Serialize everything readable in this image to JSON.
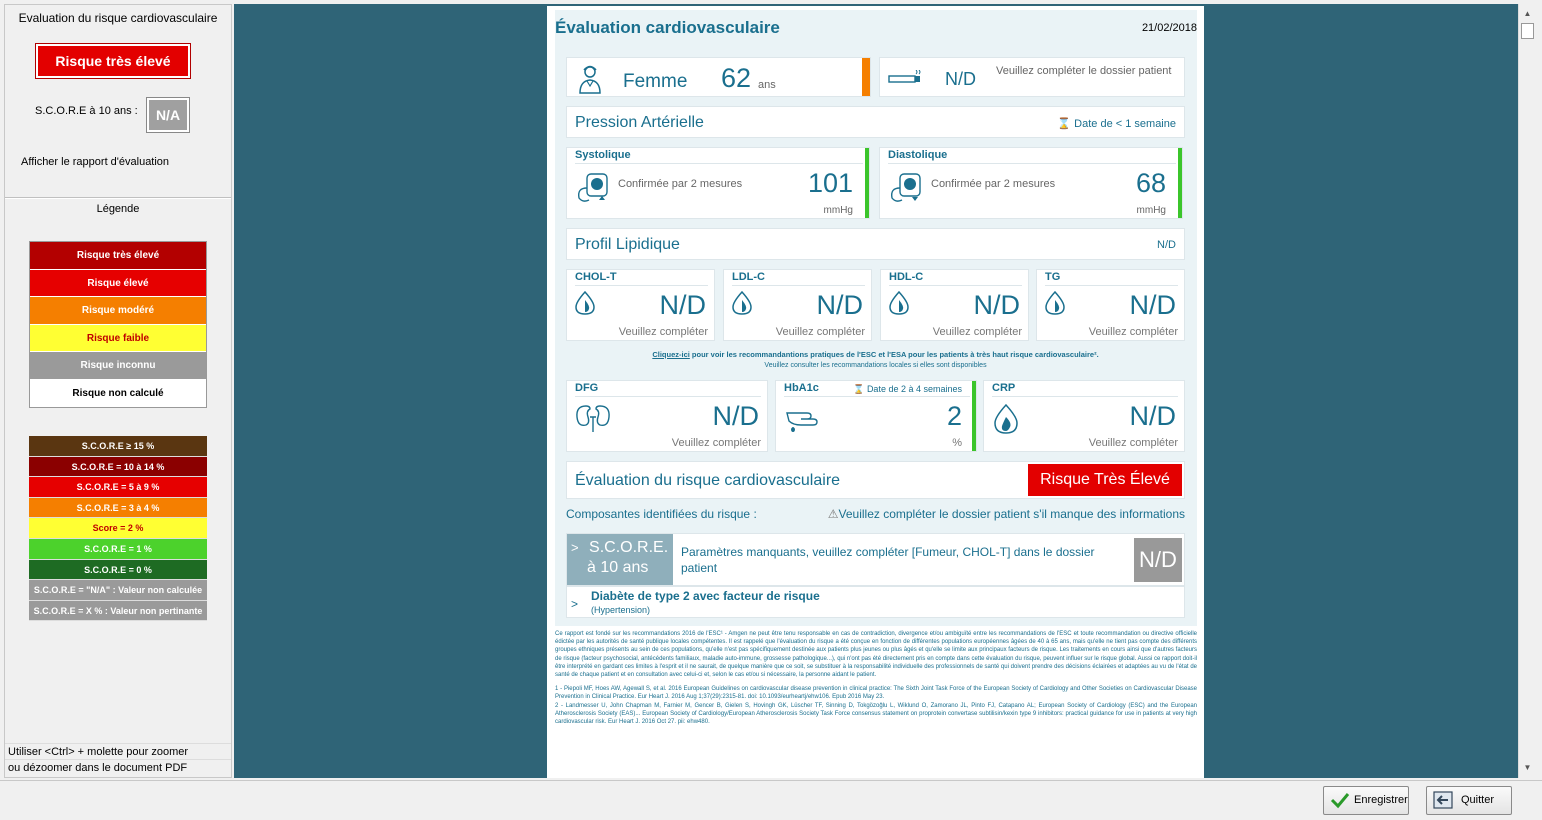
{
  "left_panel": {
    "title": "Evaluation du risque cardiovasculaire",
    "risk_badge": "Risque très élevé",
    "score_label": "S.C.O.R.E à 10 ans :",
    "score_value": "N/A",
    "report_link": "Afficher le rapport d'évaluation",
    "legend_title": "Légende",
    "legend": [
      {
        "label": "Risque très élevé",
        "bg": "#b30000",
        "fg": "#ffffff"
      },
      {
        "label": "Risque élevé",
        "bg": "#e60000",
        "fg": "#ffffff"
      },
      {
        "label": "Risque modéré",
        "bg": "#f57f00",
        "fg": "#ffffff"
      },
      {
        "label": "Risque faible",
        "bg": "#ffff33",
        "fg": "#c00000"
      },
      {
        "label": "Risque inconnu",
        "bg": "#9a9a9a",
        "fg": "#ffffff"
      },
      {
        "label": "Risque non calculé",
        "bg": "#ffffff",
        "fg": "#000000"
      }
    ],
    "score_legend": [
      {
        "label": "S.C.O.R.E ≥ 15 %",
        "bg": "#5a3611",
        "fg": "#ffffff"
      },
      {
        "label": "S.C.O.R.E = 10 à 14 %",
        "bg": "#8b0000",
        "fg": "#ffffff"
      },
      {
        "label": "S.C.O.R.E = 5 à 9 %",
        "bg": "#e60000",
        "fg": "#ffffff"
      },
      {
        "label": "S.C.O.R.E = 3 à 4 %",
        "bg": "#f57f00",
        "fg": "#ffffff"
      },
      {
        "label": "Score = 2 %",
        "bg": "#ffff33",
        "fg": "#c00000"
      },
      {
        "label": "S.C.O.R.E = 1 %",
        "bg": "#4cd22c",
        "fg": "#ffffff"
      },
      {
        "label": "S.C.O.R.E = 0 %",
        "bg": "#1e6b23",
        "fg": "#ffffff"
      },
      {
        "label": "S.C.O.R.E = \"N/A\" : Valeur non calculée",
        "bg": "#9a9a9a",
        "fg": "#ffffff"
      },
      {
        "label": "S.C.O.R.E = X % : Valeur non pertinante",
        "bg": "#9a9a9a",
        "fg": "#ffffff"
      }
    ],
    "zoom_hint": [
      "Utiliser <Ctrl> + molette pour zoomer",
      "ou dézoomer dans le document PDF"
    ]
  },
  "document": {
    "title": "Évaluation cardiovasculaire",
    "date": "21/02/2018",
    "patient": {
      "sex": "Femme",
      "age": "62",
      "age_unit": "ans"
    },
    "smoker": {
      "value": "N/D",
      "message": "Veuillez compléter le dossier patient"
    },
    "bp_section": {
      "label": "Pression Artérielle",
      "date_note": "Date de < 1 semaine"
    },
    "systolic": {
      "label": "Systolique",
      "confirm": "Confirmée par 2 mesures",
      "value": "101",
      "unit": "mmHg"
    },
    "diastolic": {
      "label": "Diastolique",
      "confirm": "Confirmée par 2 mesures",
      "value": "68",
      "unit": "mmHg"
    },
    "lipid_section": {
      "label": "Profil Lipidique",
      "status": "N/D"
    },
    "lipids": [
      {
        "label": "CHOL-T",
        "value": "N/D",
        "msg": "Veuillez compléter"
      },
      {
        "label": "LDL-C",
        "value": "N/D",
        "msg": "Veuillez compléter"
      },
      {
        "label": "HDL-C",
        "value": "N/D",
        "msg": "Veuillez compléter"
      },
      {
        "label": "TG",
        "value": "N/D",
        "msg": "Veuillez compléter"
      }
    ],
    "reco": {
      "link": "Cliquez-ici",
      "line1": " pour voir les recommandantions pratiques de l'ESC et l'ESA pour les patients à très haut risque cardiovasculaire².",
      "line2": "Veuillez consulter les recommandations locales si elles sont disponibles"
    },
    "dfg": {
      "label": "DFG",
      "value": "N/D",
      "msg": "Veuillez compléter"
    },
    "hba1c": {
      "label": "HbA1c",
      "date_note": "Date de 2 à 4 semaines",
      "value": "2",
      "unit": "%"
    },
    "crp": {
      "label": "CRP",
      "value": "N/D",
      "msg": "Veuillez compléter"
    },
    "evaluation": {
      "label": "Évaluation du risque cardiovasculaire",
      "badge": "Risque Très Élevé"
    },
    "components": {
      "label": "Composantes identifiées du risque :",
      "warning": "Veuillez compléter le dossier patient s'il manque des informations"
    },
    "score_row": {
      "chevron": ">",
      "tag_line1": "S.C.O.R.E.",
      "tag_line2": "à 10 ans",
      "text": "Paramètres manquants, veuillez compléter [Fumeur, CHOL-T] dans le dossier patient",
      "value": "N/D"
    },
    "diabetes_row": {
      "chevron": ">",
      "title": "Diabète de type 2 avec facteur de risque",
      "subtitle": "(Hypertension)"
    },
    "fine_print": [
      "Ce rapport est fondé sur les recommandations 2016 de l'ESC¹ - Amgen ne peut être tenu responsable en cas de contradiction, divergence et/ou ambiguïté entre les recommandations de l'ESC et toute recommandation ou directive officielle édictée par les autorités de santé publique locales compétentes. Il est rappelé que l'évaluation du risque a été conçue en fonction de différentes populations européennes âgées de 40 à 65 ans, mais qu'elle ne tient pas compte des différents groupes ethniques présents au sein de ces populations, qu'elle n'est pas spécifiquement destinée aux patients plus jeunes ou plus âgés et qu'elle se limite aux principaux facteurs de risque. Les traitements en cours ainsi que d'autres facteurs de risque (facteur psychosocial, antécédents familiaux, maladie auto-immune, grossesse pathologique...), qui n'ont pas été directement pris en compte dans cette évaluation du risque, peuvent influer sur le risque global. Aussi ce rapport doit-il être interprété en gardant ces limites à l'esprit et il ne saurait, de quelque manière que ce soit, se substituer à la responsabilité individuelle des professionnels de santé qui doivent prendre des décisions éclairées et adaptées au vu de l'état de santé de chaque patient et en consultation avec celui-ci et, selon le cas et/ou si nécessaire, la personne aidant le patient.",
      "1 - Piepoli MF, Hoes AW, Agewall S, et al. 2016 European Guidelines on cardiovascular disease prevention in clinical practice: The Sixth Joint Task Force of the European Society of Cardiology and Other Societies on Cardiovascular Disease Prevention in Clinical Practice. Eur Heart J. 2016 Aug 1;37(29):2315-81. doi: 10.1093/eurheartj/ehw106. Epub 2016 May 23.",
      "2 - Landmesser U, John Chapman M, Farnier M, Gencer B, Gielen S, Hovingh GK, Lüscher TF, Sinning D, Tokgözoğlu L, Wiklund O, Zamorano JL, Pinto FJ, Catapano AL; European Society of Cardiology (ESC) and the European Atherosclerosis Society (EAS)... European Society of Cardiology/European Atherosclerosis Society Task Force consensus statement on proprotein convertase subtilisin/kexin type 9 inhibitors: practical guidance for use in patients at very high cardiovascular risk. Eur Heart J. 2016 Oct 27. pii: ehw480."
    ]
  },
  "bottom_bar": {
    "save_label": "Enregistrer",
    "quit_label": "Quitter"
  },
  "colors": {
    "viewer_bg": "#2f6477",
    "accent": "#1a6f8e",
    "very_high_risk": "#e30000"
  }
}
